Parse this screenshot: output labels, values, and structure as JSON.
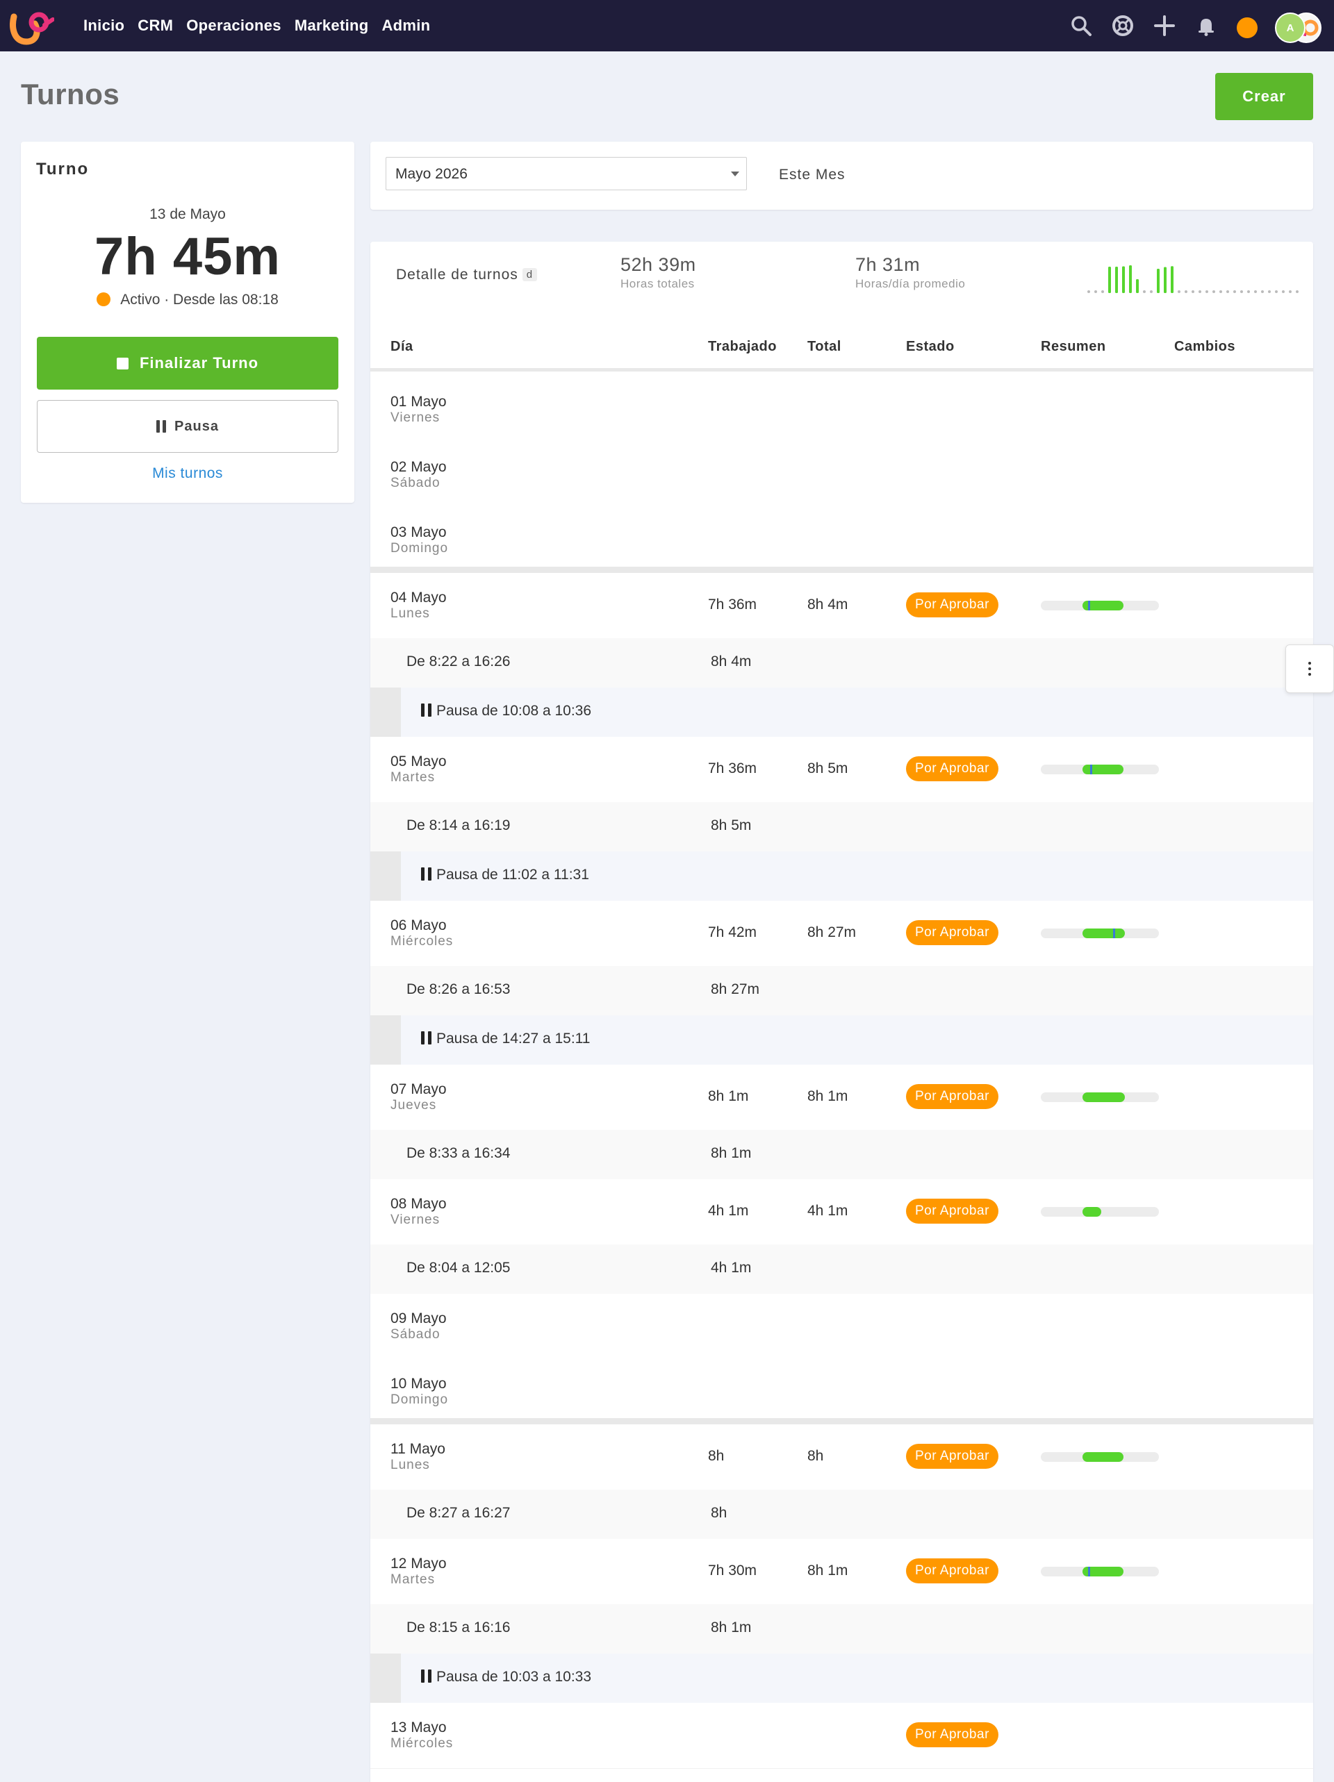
{
  "nav": {
    "links": [
      "Inicio",
      "CRM",
      "Operaciones",
      "Marketing",
      "Admin"
    ],
    "avatar_initial": "A",
    "colors": {
      "bar": "#1f1d3a",
      "status": "#ff9800"
    }
  },
  "page": {
    "title": "Turnos",
    "create_label": "Crear"
  },
  "turno_card": {
    "title": "Turno",
    "date": "13 de Mayo",
    "elapsed": "7h 45m",
    "status": "Activo · Desde las 08:18",
    "finish_label": "Finalizar Turno",
    "pause_label": "Pausa",
    "my_shifts_link": "Mis turnos"
  },
  "filter": {
    "month": "Mayo 2026",
    "this_month": "Este Mes"
  },
  "summary": {
    "label": "Detalle de turnos",
    "kbd": "d",
    "total_hours": "52h 39m",
    "total_hours_label": "Horas totales",
    "avg": "7h 31m",
    "avg_label": "Horas/día promedio",
    "sparkline_hours": [
      0,
      0,
      0,
      7.6,
      7.6,
      7.7,
      8.0,
      4.0,
      0,
      0,
      7.0,
      7.5,
      7.75,
      0,
      0,
      0,
      0,
      0,
      0,
      0,
      0,
      0,
      0,
      0,
      0,
      0,
      0,
      0,
      0,
      0,
      0
    ]
  },
  "table": {
    "headers": {
      "dia": "Día",
      "trabajado": "Trabajado",
      "total": "Total",
      "estado": "Estado",
      "resumen": "Resumen",
      "cambios": "Cambios"
    },
    "rows": [
      {
        "day": "01 Mayo",
        "weekday": "Viernes"
      },
      {
        "day": "02 Mayo",
        "weekday": "Sábado"
      },
      {
        "day": "03 Mayo",
        "weekday": "Domingo"
      },
      {
        "day": "04 Mayo",
        "weekday": "Lunes",
        "worked": "7h 36m",
        "total": "8h 4m",
        "status": "Por Aprobar",
        "shift": "De 8:22 a 16:26",
        "shift_total": "8h 4m",
        "pause": "Pausa de 10:08 a 10:36"
      },
      {
        "day": "05 Mayo",
        "weekday": "Martes",
        "worked": "7h 36m",
        "total": "8h 5m",
        "status": "Por Aprobar",
        "shift": "De 8:14 a 16:19",
        "shift_total": "8h 5m",
        "pause": "Pausa de 11:02 a 11:31"
      },
      {
        "day": "06 Mayo",
        "weekday": "Miércoles",
        "worked": "7h 42m",
        "total": "8h 27m",
        "status": "Por Aprobar",
        "shift": "De 8:26 a 16:53",
        "shift_total": "8h 27m",
        "pause": "Pausa de 14:27 a 15:11"
      },
      {
        "day": "07 Mayo",
        "weekday": "Jueves",
        "worked": "8h 1m",
        "total": "8h 1m",
        "status": "Por Aprobar",
        "shift": "De 8:33 a 16:34",
        "shift_total": "8h 1m"
      },
      {
        "day": "08 Mayo",
        "weekday": "Viernes",
        "worked": "4h 1m",
        "total": "4h 1m",
        "status": "Por Aprobar",
        "shift": "De 8:04 a 12:05",
        "shift_total": "4h 1m"
      },
      {
        "day": "09 Mayo",
        "weekday": "Sábado"
      },
      {
        "day": "10 Mayo",
        "weekday": "Domingo"
      },
      {
        "day": "11 Mayo",
        "weekday": "Lunes",
        "worked": "8h",
        "total": "8h",
        "status": "Por Aprobar",
        "shift": "De 8:27 a 16:27",
        "shift_total": "8h"
      },
      {
        "day": "12 Mayo",
        "weekday": "Martes",
        "worked": "7h 30m",
        "total": "8h 1m",
        "status": "Por Aprobar",
        "shift": "De 8:15 a 16:16",
        "shift_total": "8h 1m",
        "pause": "Pausa de 10:03 a 10:33"
      },
      {
        "day": "13 Mayo",
        "weekday": "Miércoles",
        "status": "Por Aprobar"
      }
    ]
  },
  "colors": {
    "green": "#5cb82b",
    "bar_fill": "#56d52e",
    "badge": "#ff9800",
    "pause_marker": "#3a79d6"
  }
}
